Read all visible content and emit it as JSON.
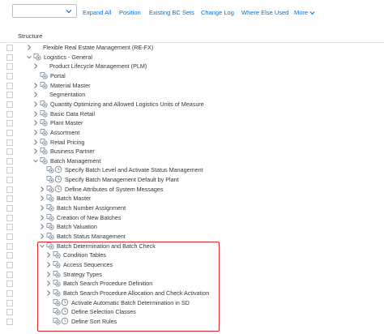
{
  "toolbar": {
    "dropdown_value": "",
    "buttons": [
      "Expand All",
      "Position",
      "Existing BC Sets",
      "Change Log",
      "Where Else Used",
      "More"
    ]
  },
  "structure_header": "Structure",
  "colors": {
    "link": "#0a6ed1",
    "highlight_border": "#d9262b",
    "text": "#32363a"
  },
  "tree": [
    {
      "label": "Flexible Real Estate Management (RE-FX)",
      "level": 0,
      "expander": "collapsed",
      "icons": []
    },
    {
      "label": "Logistics - General",
      "level": 0,
      "expander": "expanded",
      "icons": [
        "img-activity-icon"
      ]
    },
    {
      "label": "Product Lifecycle Management (PLM)",
      "level": 1,
      "expander": "collapsed",
      "icons": []
    },
    {
      "label": "Portal",
      "level": 1,
      "expander": "none",
      "icons": [
        "img-activity-icon"
      ]
    },
    {
      "label": "Material Master",
      "level": 1,
      "expander": "collapsed",
      "icons": [
        "img-activity-icon"
      ]
    },
    {
      "label": "Segmentation",
      "level": 1,
      "expander": "collapsed",
      "icons": []
    },
    {
      "label": "Quantity Optimizing and Allowed Logistics Units of Measure",
      "level": 1,
      "expander": "collapsed",
      "icons": [
        "img-activity-icon"
      ]
    },
    {
      "label": "Basic Data Retail",
      "level": 1,
      "expander": "collapsed",
      "icons": [
        "img-activity-icon"
      ]
    },
    {
      "label": "Plant Master",
      "level": 1,
      "expander": "collapsed",
      "icons": [
        "img-activity-icon"
      ]
    },
    {
      "label": "Assortment",
      "level": 1,
      "expander": "collapsed",
      "icons": [
        "img-activity-icon"
      ]
    },
    {
      "label": "Retail Pricing",
      "level": 1,
      "expander": "collapsed",
      "icons": [
        "img-activity-icon"
      ]
    },
    {
      "label": "Business Partner",
      "level": 1,
      "expander": "collapsed",
      "icons": [
        "img-activity-icon"
      ]
    },
    {
      "label": "Batch Management",
      "level": 1,
      "expander": "expanded",
      "icons": [
        "img-activity-icon"
      ]
    },
    {
      "label": "Specify Batch Level and Activate Status Management",
      "level": 2,
      "expander": "none",
      "icons": [
        "img-activity-icon",
        "clock-icon"
      ]
    },
    {
      "label": "Specify Batch Management Default by Plant",
      "level": 2,
      "expander": "none",
      "icons": [
        "img-activity-icon",
        "clock-icon"
      ]
    },
    {
      "label": "Define Attributes of System Messages",
      "level": 2,
      "expander": "collapsed",
      "icons": [
        "img-activity-icon",
        "clock-icon"
      ]
    },
    {
      "label": "Batch Master",
      "level": 2,
      "expander": "collapsed",
      "icons": [
        "img-activity-icon"
      ]
    },
    {
      "label": "Batch Number Assignment",
      "level": 2,
      "expander": "collapsed",
      "icons": [
        "img-activity-icon"
      ]
    },
    {
      "label": "Creation of New Batches",
      "level": 2,
      "expander": "collapsed",
      "icons": [
        "img-activity-icon"
      ]
    },
    {
      "label": "Batch Valuation",
      "level": 2,
      "expander": "collapsed",
      "icons": [
        "img-activity-icon"
      ]
    },
    {
      "label": "Batch Status Management",
      "level": 2,
      "expander": "collapsed",
      "icons": [
        "img-activity-icon"
      ]
    },
    {
      "label": "Batch Determination and Batch Check",
      "level": 2,
      "expander": "expanded",
      "icons": [
        "img-activity-icon"
      ]
    },
    {
      "label": "Condition Tables",
      "level": 3,
      "expander": "collapsed",
      "icons": [
        "img-activity-icon"
      ]
    },
    {
      "label": "Access Sequences",
      "level": 3,
      "expander": "collapsed",
      "icons": [
        "img-activity-icon"
      ]
    },
    {
      "label": "Strategy Types",
      "level": 3,
      "expander": "collapsed",
      "icons": [
        "img-activity-icon"
      ]
    },
    {
      "label": "Batch Search Procedure Definition",
      "level": 3,
      "expander": "collapsed",
      "icons": [
        "img-activity-icon"
      ]
    },
    {
      "label": "Batch Search Procedure Allocation and Check Activation",
      "level": 3,
      "expander": "collapsed",
      "icons": [
        "img-activity-icon"
      ]
    },
    {
      "label": "Activate Automatic Batch Determination in SD",
      "level": 3,
      "expander": "none",
      "icons": [
        "img-activity-icon",
        "clock-icon"
      ]
    },
    {
      "label": "Define Selection Classes",
      "level": 3,
      "expander": "none",
      "icons": [
        "img-activity-icon",
        "clock-icon"
      ]
    },
    {
      "label": "Define Sort Rules",
      "level": 3,
      "expander": "none",
      "icons": [
        "img-activity-icon",
        "clock-icon"
      ]
    }
  ]
}
